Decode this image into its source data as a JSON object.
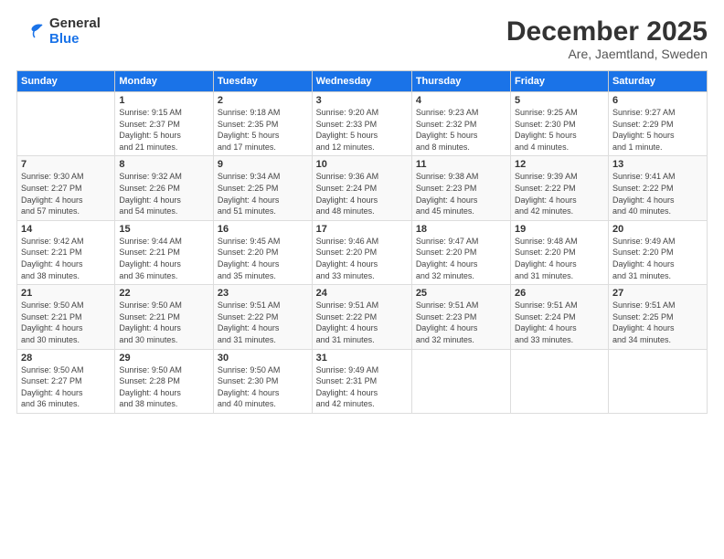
{
  "logo": {
    "general": "General",
    "blue": "Blue"
  },
  "title": "December 2025",
  "subtitle": "Are, Jaemtland, Sweden",
  "days_of_week": [
    "Sunday",
    "Monday",
    "Tuesday",
    "Wednesday",
    "Thursday",
    "Friday",
    "Saturday"
  ],
  "weeks": [
    [
      {
        "day": "",
        "info": ""
      },
      {
        "day": "1",
        "info": "Sunrise: 9:15 AM\nSunset: 2:37 PM\nDaylight: 5 hours\nand 21 minutes."
      },
      {
        "day": "2",
        "info": "Sunrise: 9:18 AM\nSunset: 2:35 PM\nDaylight: 5 hours\nand 17 minutes."
      },
      {
        "day": "3",
        "info": "Sunrise: 9:20 AM\nSunset: 2:33 PM\nDaylight: 5 hours\nand 12 minutes."
      },
      {
        "day": "4",
        "info": "Sunrise: 9:23 AM\nSunset: 2:32 PM\nDaylight: 5 hours\nand 8 minutes."
      },
      {
        "day": "5",
        "info": "Sunrise: 9:25 AM\nSunset: 2:30 PM\nDaylight: 5 hours\nand 4 minutes."
      },
      {
        "day": "6",
        "info": "Sunrise: 9:27 AM\nSunset: 2:29 PM\nDaylight: 5 hours\nand 1 minute."
      }
    ],
    [
      {
        "day": "7",
        "info": "Sunrise: 9:30 AM\nSunset: 2:27 PM\nDaylight: 4 hours\nand 57 minutes."
      },
      {
        "day": "8",
        "info": "Sunrise: 9:32 AM\nSunset: 2:26 PM\nDaylight: 4 hours\nand 54 minutes."
      },
      {
        "day": "9",
        "info": "Sunrise: 9:34 AM\nSunset: 2:25 PM\nDaylight: 4 hours\nand 51 minutes."
      },
      {
        "day": "10",
        "info": "Sunrise: 9:36 AM\nSunset: 2:24 PM\nDaylight: 4 hours\nand 48 minutes."
      },
      {
        "day": "11",
        "info": "Sunrise: 9:38 AM\nSunset: 2:23 PM\nDaylight: 4 hours\nand 45 minutes."
      },
      {
        "day": "12",
        "info": "Sunrise: 9:39 AM\nSunset: 2:22 PM\nDaylight: 4 hours\nand 42 minutes."
      },
      {
        "day": "13",
        "info": "Sunrise: 9:41 AM\nSunset: 2:22 PM\nDaylight: 4 hours\nand 40 minutes."
      }
    ],
    [
      {
        "day": "14",
        "info": "Sunrise: 9:42 AM\nSunset: 2:21 PM\nDaylight: 4 hours\nand 38 minutes."
      },
      {
        "day": "15",
        "info": "Sunrise: 9:44 AM\nSunset: 2:21 PM\nDaylight: 4 hours\nand 36 minutes."
      },
      {
        "day": "16",
        "info": "Sunrise: 9:45 AM\nSunset: 2:20 PM\nDaylight: 4 hours\nand 35 minutes."
      },
      {
        "day": "17",
        "info": "Sunrise: 9:46 AM\nSunset: 2:20 PM\nDaylight: 4 hours\nand 33 minutes."
      },
      {
        "day": "18",
        "info": "Sunrise: 9:47 AM\nSunset: 2:20 PM\nDaylight: 4 hours\nand 32 minutes."
      },
      {
        "day": "19",
        "info": "Sunrise: 9:48 AM\nSunset: 2:20 PM\nDaylight: 4 hours\nand 31 minutes."
      },
      {
        "day": "20",
        "info": "Sunrise: 9:49 AM\nSunset: 2:20 PM\nDaylight: 4 hours\nand 31 minutes."
      }
    ],
    [
      {
        "day": "21",
        "info": "Sunrise: 9:50 AM\nSunset: 2:21 PM\nDaylight: 4 hours\nand 30 minutes."
      },
      {
        "day": "22",
        "info": "Sunrise: 9:50 AM\nSunset: 2:21 PM\nDaylight: 4 hours\nand 30 minutes."
      },
      {
        "day": "23",
        "info": "Sunrise: 9:51 AM\nSunset: 2:22 PM\nDaylight: 4 hours\nand 31 minutes."
      },
      {
        "day": "24",
        "info": "Sunrise: 9:51 AM\nSunset: 2:22 PM\nDaylight: 4 hours\nand 31 minutes."
      },
      {
        "day": "25",
        "info": "Sunrise: 9:51 AM\nSunset: 2:23 PM\nDaylight: 4 hours\nand 32 minutes."
      },
      {
        "day": "26",
        "info": "Sunrise: 9:51 AM\nSunset: 2:24 PM\nDaylight: 4 hours\nand 33 minutes."
      },
      {
        "day": "27",
        "info": "Sunrise: 9:51 AM\nSunset: 2:25 PM\nDaylight: 4 hours\nand 34 minutes."
      }
    ],
    [
      {
        "day": "28",
        "info": "Sunrise: 9:50 AM\nSunset: 2:27 PM\nDaylight: 4 hours\nand 36 minutes."
      },
      {
        "day": "29",
        "info": "Sunrise: 9:50 AM\nSunset: 2:28 PM\nDaylight: 4 hours\nand 38 minutes."
      },
      {
        "day": "30",
        "info": "Sunrise: 9:50 AM\nSunset: 2:30 PM\nDaylight: 4 hours\nand 40 minutes."
      },
      {
        "day": "31",
        "info": "Sunrise: 9:49 AM\nSunset: 2:31 PM\nDaylight: 4 hours\nand 42 minutes."
      },
      {
        "day": "",
        "info": ""
      },
      {
        "day": "",
        "info": ""
      },
      {
        "day": "",
        "info": ""
      }
    ]
  ]
}
